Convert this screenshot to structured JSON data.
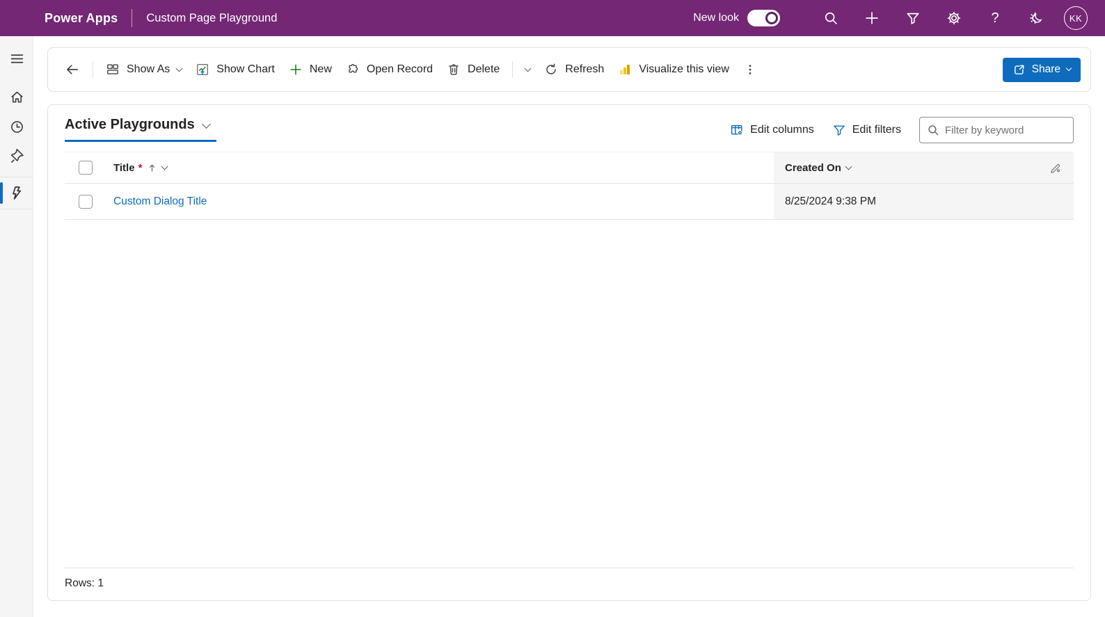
{
  "header": {
    "brand": "Power Apps",
    "app_title": "Custom Page Playground",
    "new_look_label": "New look",
    "new_look_on": true,
    "avatar_initials": "KK"
  },
  "sidebar": {
    "items": [
      {
        "name": "menu",
        "icon": "hamburger"
      },
      {
        "name": "home",
        "icon": "house"
      },
      {
        "name": "recent",
        "icon": "clock"
      },
      {
        "name": "pinned",
        "icon": "pushpin"
      },
      {
        "name": "playgrounds",
        "icon": "lightning-bolt",
        "selected": true
      }
    ]
  },
  "command_bar": {
    "show_as_label": "Show As",
    "show_chart_label": "Show Chart",
    "new_label": "New",
    "open_record_label": "Open Record",
    "delete_label": "Delete",
    "refresh_label": "Refresh",
    "visualize_label": "Visualize this view",
    "share_label": "Share"
  },
  "view": {
    "title": "Active Playgrounds",
    "edit_columns_label": "Edit columns",
    "edit_filters_label": "Edit filters",
    "filter_placeholder": "Filter by keyword",
    "table": {
      "title_column": "Title",
      "required_marker": "*",
      "title_sort": "ascending",
      "created_on_column": "Created On",
      "rows": [
        {
          "title": "Custom Dialog Title",
          "created_on": "8/25/2024 9:38 PM"
        }
      ]
    },
    "rows_count_label": "Rows: 1"
  },
  "icons": {
    "search-icon": "magnifier",
    "add-icon": "plus",
    "filter-icon": "funnel",
    "settings-icon": "gear",
    "help-icon": "question-mark",
    "theme-icon": "sun-and-moon",
    "menu-icon": "hamburger",
    "home-icon": "house",
    "recent-icon": "clock",
    "pinned-icon": "pushpin",
    "playgrounds-icon": "lightning-bolt",
    "back-icon": "arrow-left",
    "show-as-icon": "layout-grid",
    "show-chart-icon": "sparkline-chart-with-up-arrow",
    "new-icon": "green-plus",
    "open-record-icon": "puzzle-piece",
    "delete-icon": "trash-can",
    "refresh-icon": "arrow-clockwise",
    "visualize-icon": "power-bi-bars",
    "more-icon": "vertical-ellipsis",
    "share-icon": "share-box-arrow",
    "edit-columns-icon": "table-with-gear",
    "edit-filters-icon": "blue-funnel",
    "keyword-search-icon": "magnifier",
    "sort-ascending-icon": "arrow-up",
    "edit-column-icon": "pencil"
  },
  "colors": {
    "header_purple": "#742774",
    "accent_blue": "#0f6cbd",
    "link_blue": "#0f6cbd",
    "green": "#107c10",
    "powerbi_yellow": "#f2c811",
    "required_red": "#c50f1f",
    "sidebar_gray": "#f5f5f5",
    "created_on_cell_gray": "#f5f5f5"
  }
}
